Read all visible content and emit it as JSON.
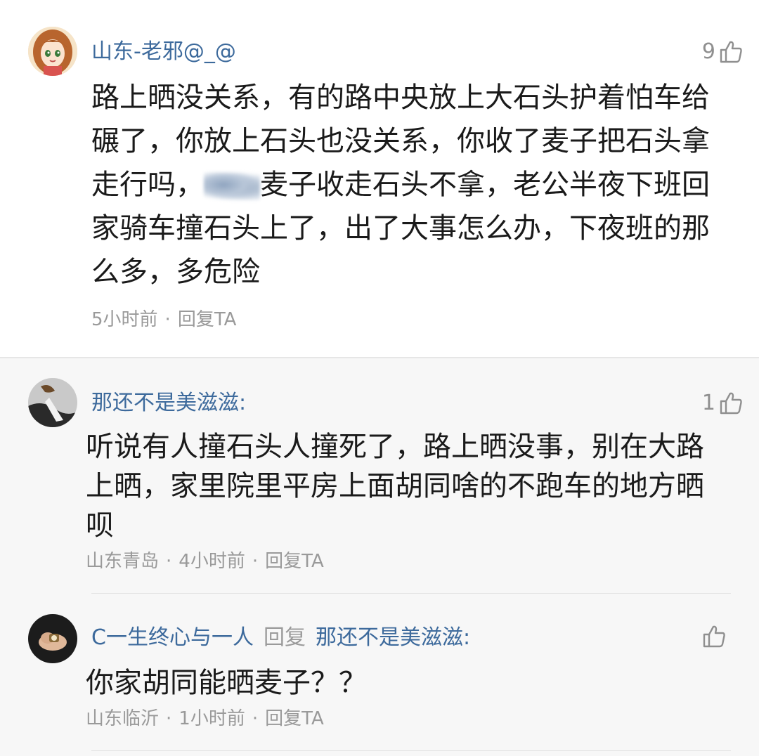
{
  "comments": [
    {
      "username": "山东-老邪@_@",
      "likes": "9",
      "text_before_blur": "路上晒没关系，有的路中央放上大石头护着怕车给碾了，你放上石头也没关系，你收了麦子把石头拿走行吗，",
      "text_after_blur": "麦子收走石头不拿，老公半夜下班回家骑车撞石头上了，出了大事怎么办，下夜班的那么多，多危险",
      "time": "5小时前",
      "reply_label": "回复TA"
    }
  ],
  "replies": [
    {
      "username": "那还不是美滋滋:",
      "likes": "1",
      "text": "听说有人撞石头人撞死了，路上晒没事，别在大路上晒，家里院里平房上面胡同啥的不跑车的地方晒呗",
      "location": "山东青岛",
      "time": "4小时前",
      "reply_label": "回复TA"
    },
    {
      "username": "C一生终心与一人",
      "reply_word": "回复",
      "reply_to": "那还不是美滋滋:",
      "likes": "",
      "text": "你家胡同能晒麦子？？",
      "location": "山东临沂",
      "time": "1小时前",
      "reply_label": "回复TA"
    }
  ],
  "icons": {
    "like": "thumbs-up-icon"
  },
  "colors": {
    "username": "#3d6a9c",
    "meta": "#9a9a9a",
    "reply_bg": "#f7f7f7"
  }
}
